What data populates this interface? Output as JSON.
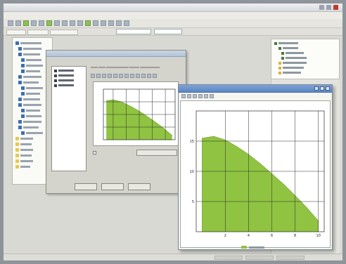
{
  "colors": {
    "curve_fill": "#8fc341",
    "curve_stroke": "#7aa834",
    "grid": "#2b2b2b",
    "window_title": "#5b86c4"
  },
  "icons": [
    "window-minimize-icon",
    "window-maximize-icon",
    "window-close-icon",
    "toolbar-icon",
    "tree-node-icon",
    "checkbox-icon"
  ],
  "chart_data": [
    {
      "type": "area",
      "x": [
        0,
        1,
        2,
        3,
        4,
        5,
        6,
        7,
        8,
        9,
        10
      ],
      "y": [
        15.5,
        15.8,
        15.2,
        14.1,
        12.8,
        11.3,
        9.6,
        7.9,
        6.0,
        4.0,
        1.8
      ],
      "xlim": [
        -0.5,
        10.5
      ],
      "ylim": [
        0,
        20
      ],
      "x_ticks": [
        2,
        4,
        6,
        8,
        10
      ],
      "y_ticks": [
        5,
        10,
        15
      ],
      "grid": true
    },
    {
      "type": "area",
      "x": [
        0,
        1,
        2,
        3,
        4,
        5,
        6,
        7,
        8,
        9,
        10
      ],
      "y": [
        15.5,
        15.8,
        15.2,
        14.1,
        12.8,
        11.3,
        9.6,
        7.9,
        6.0,
        4.0,
        1.8
      ],
      "xlim": [
        -0.5,
        10.5
      ],
      "ylim": [
        0,
        20
      ],
      "grid": true
    }
  ]
}
